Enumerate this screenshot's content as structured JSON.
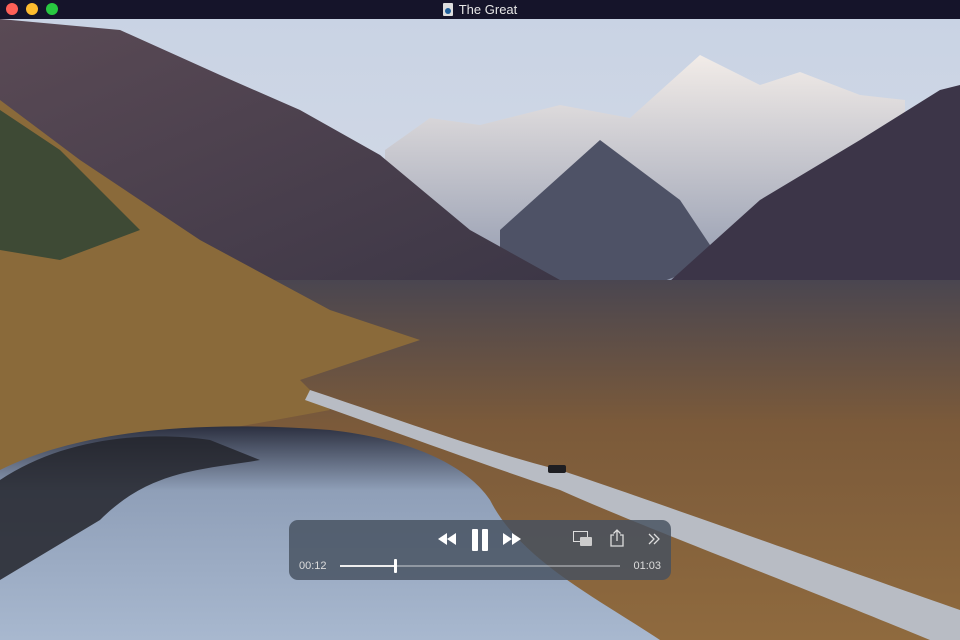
{
  "window": {
    "title": "The Great"
  },
  "player": {
    "current_time": "00:12",
    "duration": "01:03",
    "progress": 0.196,
    "state": "playing"
  },
  "colors": {
    "close": "#fe5f57",
    "minimize": "#febc2e",
    "zoom": "#28c840"
  }
}
